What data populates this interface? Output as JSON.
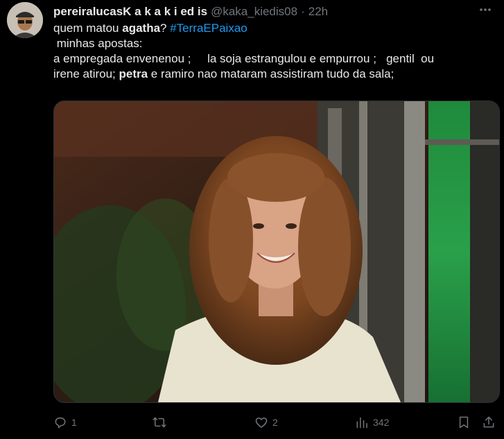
{
  "tweet": {
    "display_name": "pereiralucasK a k a k i ed is",
    "handle": "@kaka_kiedis08",
    "separator": "·",
    "time": "22h",
    "text": {
      "line1": {
        "a": "quem matou ",
        "bold": "agatha",
        "b": "? ",
        "hashtag": "#TerraEPaixao"
      },
      "line2": " minhas apostas:",
      "line3": "a empregada envenenou ;     la soja estrangulou e empurrou ;   gentil  ou",
      "line4": {
        "a": "irene atirou; ",
        "bold": "petra",
        "b": " e ramiro nao mataram assistiram tudo da sala;"
      }
    }
  },
  "actions": {
    "reply_count": "1",
    "retweet_count": "",
    "like_count": "2",
    "views_count": "342"
  },
  "icons": {
    "avatar": "avatar-image",
    "more": "more-icon",
    "reply": "reply-icon",
    "retweet": "retweet-icon",
    "like": "heart-icon",
    "views": "views-icon",
    "bookmark": "bookmark-icon",
    "share": "share-icon"
  },
  "colors": {
    "background": "#000000",
    "text": "#e7e9ea",
    "muted": "#71767b",
    "hashtag": "#1d9bf0"
  }
}
